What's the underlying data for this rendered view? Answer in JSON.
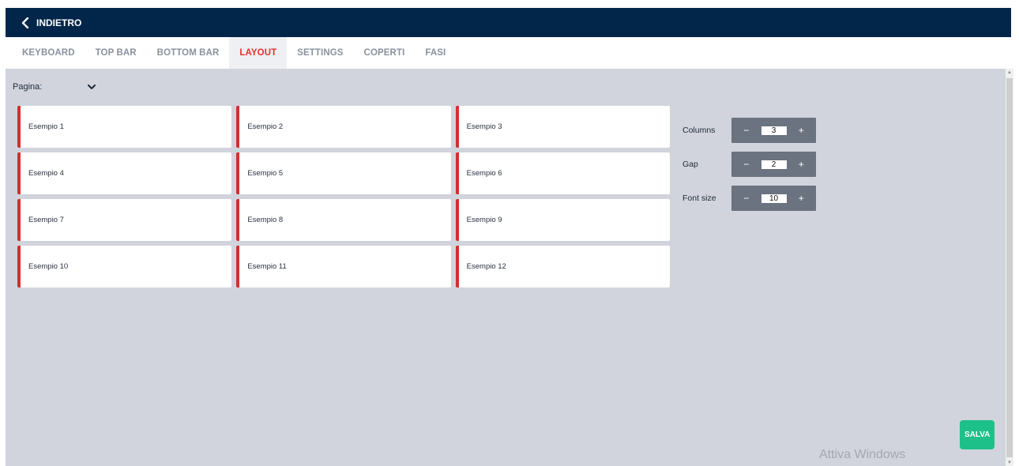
{
  "header": {
    "back_label": "INDIETRO"
  },
  "tabs": [
    {
      "label": "KEYBOARD",
      "active": false
    },
    {
      "label": "TOP BAR",
      "active": false
    },
    {
      "label": "BOTTOM BAR",
      "active": false
    },
    {
      "label": "LAYOUT",
      "active": true
    },
    {
      "label": "SETTINGS",
      "active": false
    },
    {
      "label": "COPERTI",
      "active": false
    },
    {
      "label": "FASI",
      "active": false
    }
  ],
  "page_selector": {
    "label": "Pagina:",
    "value": ""
  },
  "grid": {
    "items": [
      "Esempio 1",
      "Esempio 2",
      "Esempio 3",
      "Esempio 4",
      "Esempio 5",
      "Esempio 6",
      "Esempio 7",
      "Esempio 8",
      "Esempio 9",
      "Esempio 10",
      "Esempio 11",
      "Esempio 12"
    ]
  },
  "controls": {
    "columns": {
      "label": "Columns",
      "value": "3",
      "minus": "−",
      "plus": "+"
    },
    "gap": {
      "label": "Gap",
      "value": "2",
      "minus": "−",
      "plus": "+"
    },
    "font_size": {
      "label": "Font size",
      "value": "10",
      "minus": "−",
      "plus": "+"
    }
  },
  "save_button": "SALVA",
  "watermark": "Attiva Windows",
  "colors": {
    "header_bg": "#022649",
    "active_tab": "#e5302a",
    "cell_accent": "#d32f2f",
    "save_bg": "#1ec08a",
    "stepper_bg": "#6b7280",
    "content_bg": "#d1d4dc"
  },
  "icons": {
    "back": "chevron-left-icon",
    "dropdown": "chevron-down-icon"
  }
}
